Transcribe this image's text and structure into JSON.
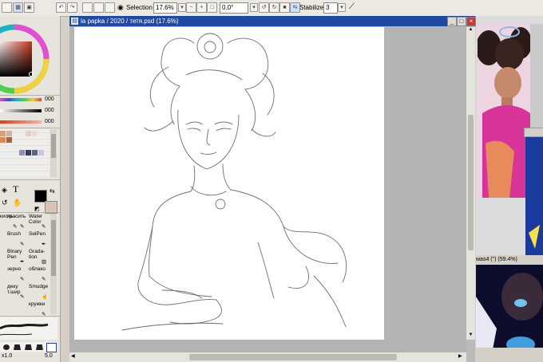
{
  "toolbar": {
    "selection_label": "Selection",
    "zoom_value": "17.6%",
    "rotation_value": "0.0°",
    "stabilizer_label": "Stabilizer",
    "stabilizer_value": "3"
  },
  "color_panel": {
    "slider_values": [
      "000",
      "000",
      "000"
    ],
    "main_color": "#000000",
    "sub_color": "#d9c3b4"
  },
  "brush_tools": [
    {
      "label": "кисть",
      "row": 0,
      "col": 0
    },
    {
      "label": "красить",
      "row": 0,
      "col": 1
    },
    {
      "label": "Water Color",
      "row": 0,
      "col": 2
    },
    {
      "label": "Brush",
      "row": 1,
      "col": 0
    },
    {
      "label": "SelPen",
      "row": 1,
      "col": 2
    },
    {
      "label": "Binary Pen",
      "row": 2,
      "col": 0
    },
    {
      "label": "Grada-tion",
      "row": 2,
      "col": 2
    },
    {
      "label": "зерно",
      "row": 3,
      "col": 0
    },
    {
      "label": "облако",
      "row": 3,
      "col": 2
    },
    {
      "label": "деку т.шир",
      "row": 4,
      "col": 0
    },
    {
      "label": "Smudge",
      "row": 4,
      "col": 2
    },
    {
      "label": "кружки",
      "row": 5,
      "col": 2
    }
  ],
  "brush_size": {
    "min": "x1.0",
    "max": "5.0"
  },
  "canvas_window": {
    "title": "la papka / 2020 / тетя.psd (17.6%)"
  },
  "reference_window": {
    "title": "was4 (\") (59.4%)"
  }
}
